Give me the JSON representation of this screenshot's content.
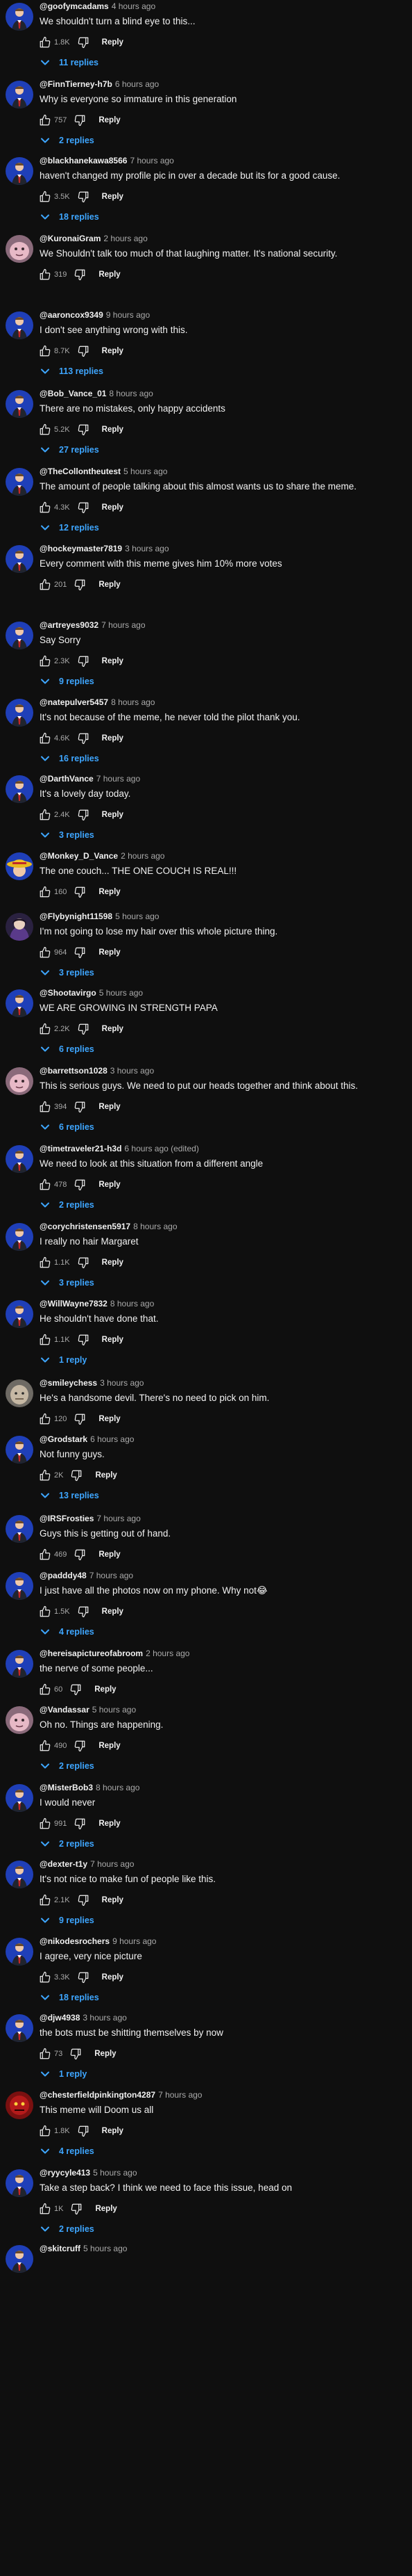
{
  "ui": {
    "reply_label": "Reply",
    "colors": {
      "background": "#0f0f0f",
      "text": "#f1f1f1",
      "secondary_text": "#aaaaaa",
      "link": "#3ea6ff",
      "avatar_blue": "#1f3fb8"
    }
  },
  "comments": [
    {
      "author": "@goofymcadams",
      "time": "4 hours ago",
      "text": "We shouldn't turn a blind eye to this...",
      "likes": "1.8K",
      "replies": "11 replies",
      "avatar": "blue-man"
    },
    {
      "author": "@FinnTierney-h7b",
      "time": "6 hours ago",
      "text": "Why is everyone so immature in this generation",
      "likes": "757",
      "replies": "2 replies",
      "avatar": "blue-man"
    },
    {
      "author": "@blackhanekawa8566",
      "time": "7 hours ago",
      "text": "haven't changed my profile pic in over a decade but its for a good cause.",
      "likes": "3.5K",
      "replies": "18 replies",
      "avatar": "blue-man"
    },
    {
      "author": "@KuronaiGram",
      "time": "2 hours ago",
      "text": "We Shouldn't talk too much of that laughing matter. It's national security.",
      "likes": "319",
      "replies": "",
      "avatar": "pink-face"
    },
    {
      "author": "@aaroncox9349",
      "time": "9 hours ago",
      "text": "I don't see anything wrong with this.",
      "likes": "8.7K",
      "replies": "113 replies",
      "avatar": "blue-man"
    },
    {
      "author": "@Bob_Vance_01",
      "time": "8 hours ago",
      "text": "There are no mistakes, only happy accidents",
      "likes": "5.2K",
      "replies": "27 replies",
      "avatar": "blue-man"
    },
    {
      "author": "@TheCollontheutest",
      "time": "5 hours ago",
      "text": "The amount of people talking about this almost wants us to share the meme.",
      "likes": "4.3K",
      "replies": "12 replies",
      "avatar": "blue-man"
    },
    {
      "author": "@hockeymaster7819",
      "time": "3 hours ago",
      "text": "Every comment with this meme gives him 10% more votes",
      "likes": "201",
      "replies": "",
      "avatar": "blue-man"
    },
    {
      "author": "@artreyes9032",
      "time": "7 hours ago",
      "text": "Say Sorry",
      "likes": "2.3K",
      "replies": "9 replies",
      "avatar": "blue-man"
    },
    {
      "author": "@natepulver5457",
      "time": "8 hours ago",
      "text": "It's not because of the meme, he never told the pilot thank you.",
      "likes": "4.6K",
      "replies": "16 replies",
      "avatar": "blue-man"
    },
    {
      "author": "@DarthVance",
      "time": "7 hours ago",
      "text": "It's a lovely day today.",
      "likes": "2.4K",
      "replies": "3 replies",
      "avatar": "blue-man"
    },
    {
      "author": "@Monkey_D_Vance",
      "time": "2 hours ago",
      "text": "The one couch... THE ONE COUCH IS REAL!!!",
      "likes": "160",
      "replies": "",
      "avatar": "straw-hat"
    },
    {
      "author": "@Flybynight11598",
      "time": "5 hours ago",
      "text": "I'm not going to lose my hair over this whole picture thing.",
      "likes": "964",
      "replies": "3 replies",
      "avatar": "dark-anime"
    },
    {
      "author": "@Shootavirgo",
      "time": "5 hours ago",
      "text": "WE ARE GROWING IN STRENGTH PAPA",
      "likes": "2.2K",
      "replies": "6 replies",
      "avatar": "blue-man"
    },
    {
      "author": "@barrettson1028",
      "time": "3 hours ago",
      "text": "This is serious guys. We need to put our heads together and think about this.",
      "likes": "394",
      "replies": "6 replies",
      "avatar": "pink-face"
    },
    {
      "author": "@timetraveler21-h3d",
      "time": "6 hours ago (edited)",
      "text": "We need to look at this situation from a different angle",
      "likes": "478",
      "replies": "2 replies",
      "avatar": "blue-man"
    },
    {
      "author": "@corychristensen5917",
      "time": "8 hours ago",
      "text": "I really no hair Margaret",
      "likes": "1.1K",
      "replies": "3 replies",
      "avatar": "blue-man"
    },
    {
      "author": "@WillWayne7832",
      "time": "8 hours ago",
      "text": "He shouldn't have done that.",
      "likes": "1.1K",
      "replies": "1 reply",
      "avatar": "blue-man"
    },
    {
      "author": "@smileychess",
      "time": "3 hours ago",
      "text": "He's a handsome devil.  There's no need to pick on him.",
      "likes": "120",
      "replies": "",
      "avatar": "gray-face"
    },
    {
      "author": "@Grodstark",
      "time": "6 hours ago",
      "text": "Not funny guys.",
      "likes": "2K",
      "replies": "13 replies",
      "avatar": "blue-man"
    },
    {
      "author": "@IRSFrosties",
      "time": "7 hours ago",
      "text": "Guys this is getting out of hand.",
      "likes": "469",
      "replies": "",
      "avatar": "blue-man"
    },
    {
      "author": "@padddy48",
      "time": "7 hours ago",
      "text": "I just have all the photos now on my phone. Why not😂",
      "likes": "1.5K",
      "replies": "4 replies",
      "avatar": "blue-man"
    },
    {
      "author": "@hereisapictureofabroom",
      "time": "2 hours ago",
      "text": "the nerve of some people...",
      "likes": "60",
      "replies": "",
      "avatar": "blue-man"
    },
    {
      "author": "@Vandassar",
      "time": "5 hours ago",
      "text": "Oh no. Things are happening.",
      "likes": "490",
      "replies": "2 replies",
      "avatar": "pink-face"
    },
    {
      "author": "@MisterBob3",
      "time": "8 hours ago",
      "text": "I would never",
      "likes": "991",
      "replies": "2 replies",
      "avatar": "blue-man"
    },
    {
      "author": "@dexter-t1y",
      "time": "7 hours ago",
      "text": "It's not nice to make fun of people like this.",
      "likes": "2.1K",
      "replies": "9 replies",
      "avatar": "blue-man"
    },
    {
      "author": "@nikodesrochers",
      "time": "9 hours ago",
      "text": "I agree, very nice picture",
      "likes": "3.3K",
      "replies": "18 replies",
      "avatar": "blue-man"
    },
    {
      "author": "@djw4938",
      "time": "3 hours ago",
      "text": "the bots must be shitting themselves by now",
      "likes": "73",
      "replies": "1 reply",
      "avatar": "blue-man"
    },
    {
      "author": "@chesterfieldpinkington4287",
      "time": "7 hours ago",
      "text": "This meme will Doom us all",
      "likes": "1.8K",
      "replies": "4 replies",
      "avatar": "red-doom"
    },
    {
      "author": "@ryycyle413",
      "time": "5 hours ago",
      "text": "Take a step back? I think we need to face this issue, head on",
      "likes": "1K",
      "replies": "2 replies",
      "avatar": "blue-man"
    },
    {
      "author": "@skitcruff",
      "time": "5 hours ago",
      "text": "",
      "likes": "",
      "replies": "",
      "avatar": "blue-man"
    }
  ]
}
